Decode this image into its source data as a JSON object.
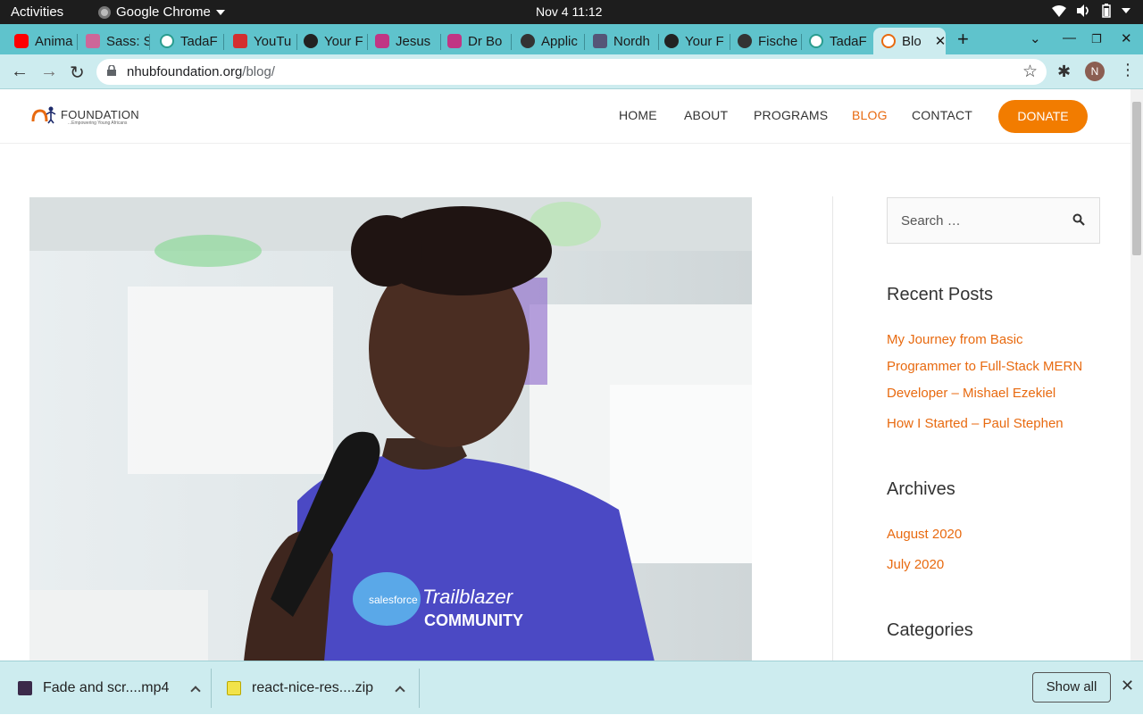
{
  "system": {
    "activities": "Activities",
    "app_name": "Google Chrome",
    "clock": "Nov 4  11:12"
  },
  "tabs": [
    {
      "label": "Anima",
      "icon": "youtube-icon",
      "color": "#ff0000"
    },
    {
      "label": "Sass: S",
      "icon": "sass-icon",
      "color": "#cd6799"
    },
    {
      "label": "TadaF",
      "icon": "tadaf-icon",
      "color": "#2a9d8f"
    },
    {
      "label": "YouTu",
      "icon": "download-icon",
      "color": "#d32f2f"
    },
    {
      "label": "Your F",
      "icon": "github-icon",
      "color": "#222222"
    },
    {
      "label": "Jesus",
      "icon": "instagram-icon",
      "color": "#c13584"
    },
    {
      "label": "Dr Bo",
      "icon": "instagram-icon",
      "color": "#c13584"
    },
    {
      "label": "Applic",
      "icon": "globe-icon",
      "color": "#333333"
    },
    {
      "label": "Nordh",
      "icon": "nordh-icon",
      "color": "#555577"
    },
    {
      "label": "Your F",
      "icon": "github-icon",
      "color": "#222222"
    },
    {
      "label": "Fische",
      "icon": "globe-icon",
      "color": "#333333"
    },
    {
      "label": "TadaF",
      "icon": "tadaf-icon",
      "color": "#2a9d8f"
    },
    {
      "label": "Blo",
      "icon": "nhub-icon",
      "color": "#e86a10",
      "active": true
    }
  ],
  "toolbar": {
    "url_domain": "nhubfoundation.org",
    "url_path": "/blog/",
    "profile_initial": "N"
  },
  "site": {
    "logo_text": "FOUNDATION",
    "logo_tagline": "...Empowering Young Africans",
    "nav": [
      "HOME",
      "ABOUT",
      "PROGRAMS",
      "BLOG",
      "CONTACT"
    ],
    "active_nav": "BLOG",
    "donate_label": "DONATE",
    "hero_alt": "Speaker holding a microphone wearing a Trailblazer Community t-shirt",
    "shirt_text_1": "Trailblazer",
    "shirt_text_2": "COMMUNITY",
    "shirt_logo": "salesforce"
  },
  "sidebar": {
    "search_placeholder": "Search …",
    "recent_posts_title": "Recent Posts",
    "recent_posts": [
      "My Journey from Basic",
      "Programmer to Full-Stack MERN",
      "Developer – Mishael Ezekiel",
      "How I Started – Paul Stephen"
    ],
    "archives_title": "Archives",
    "archives": [
      "August 2020",
      "July 2020"
    ],
    "categories_title": "Categories"
  },
  "downloads": {
    "items": [
      "Fade and scr....mp4",
      "react-nice-res....zip"
    ],
    "show_all": "Show all"
  },
  "colors": {
    "accent": "#e86a10",
    "donate": "#f27c00",
    "chrome_frame": "#5fc3cc"
  }
}
